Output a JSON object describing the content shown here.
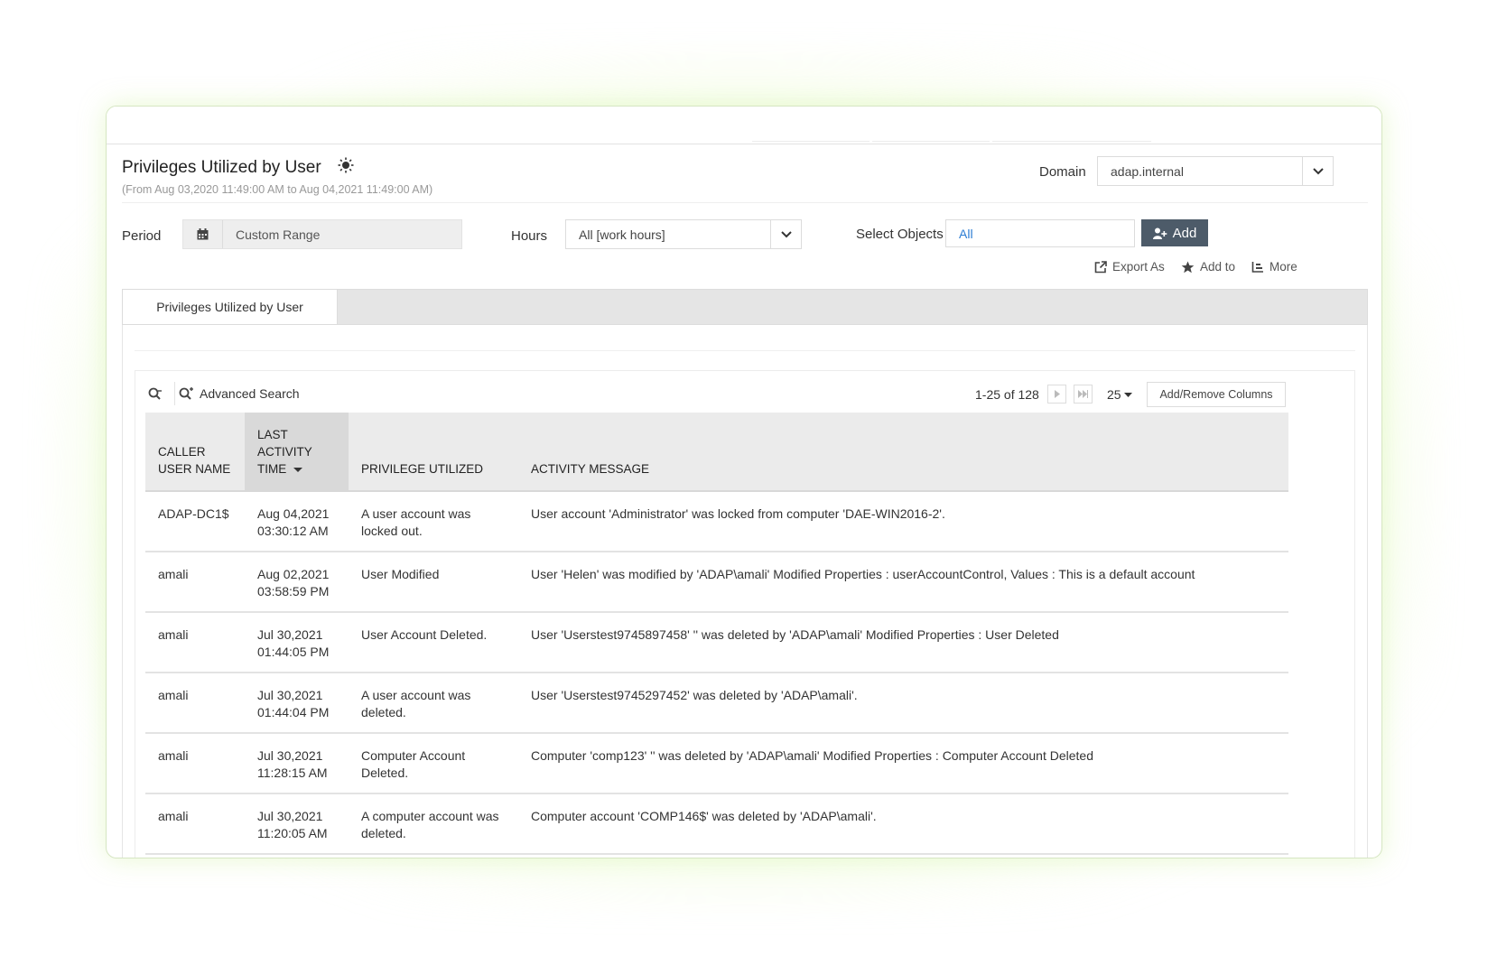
{
  "report": {
    "title": "Privileges Utilized by User",
    "subtitle": "(From Aug 03,2020 11:49:00 AM to Aug 04,2021 11:49:00 AM)"
  },
  "domain": {
    "label": "Domain",
    "value": "adap.internal"
  },
  "filters": {
    "period_label": "Period",
    "period_value": "Custom Range",
    "hours_label": "Hours",
    "hours_value": "All [work hours]",
    "objects_label": "Select Objects",
    "objects_value": "All",
    "add_label": "Add"
  },
  "actions": {
    "export": "Export As",
    "add_to": "Add to",
    "more": "More"
  },
  "tabs": [
    {
      "label": "Privileges Utilized by User"
    }
  ],
  "toolbar": {
    "advanced_search": "Advanced Search",
    "pagination": "1-25 of 128",
    "per_page": "25",
    "columns_button": "Add/Remove Columns"
  },
  "table": {
    "columns": [
      "CALLER USER NAME",
      "LAST ACTIVITY TIME",
      "PRIVILEGE UTILIZED",
      "ACTIVITY MESSAGE"
    ],
    "rows": [
      {
        "user": "ADAP-DC1$",
        "time": "Aug 04,2021 03:30:12 AM",
        "privilege": "A user account was locked out.",
        "message": "User account 'Administrator' was locked from computer 'DAE-WIN2016-2'."
      },
      {
        "user": "amali",
        "time": "Aug 02,2021 03:58:59 PM",
        "privilege": "User Modified",
        "message": "User 'Helen' was modified by 'ADAP\\amali' Modified Properties : userAccountControl, Values : This is a default account"
      },
      {
        "user": "amali",
        "time": "Jul 30,2021 01:44:05 PM",
        "privilege": "User Account Deleted.",
        "message": "User 'Userstest9745897458' '' was deleted by 'ADAP\\amali' Modified Properties : User Deleted"
      },
      {
        "user": "amali",
        "time": "Jul 30,2021 01:44:04 PM",
        "privilege": "A user account was deleted.",
        "message": "User 'Userstest9745297452' was deleted by 'ADAP\\amali'."
      },
      {
        "user": "amali",
        "time": "Jul 30,2021 11:28:15 AM",
        "privilege": "Computer Account Deleted.",
        "message": "Computer 'comp123' '' was deleted by 'ADAP\\amali' Modified Properties : Computer Account Deleted"
      },
      {
        "user": "amali",
        "time": "Jul 30,2021 11:20:05 AM",
        "privilege": "A computer account was deleted.",
        "message": "Computer account 'COMP146$' was deleted by 'ADAP\\amali'."
      }
    ]
  },
  "colors": {
    "accent_button": "#4d5b69",
    "link_blue": "#2b7cd3",
    "glow": "#d6f7a0"
  }
}
